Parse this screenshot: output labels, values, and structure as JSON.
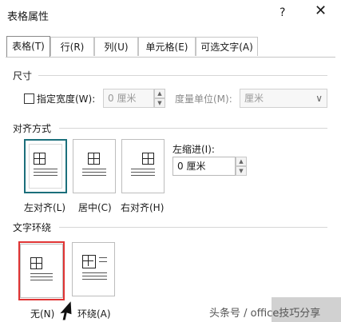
{
  "dialog": {
    "title": "表格属性",
    "help": "?",
    "close": "✕"
  },
  "tabs": [
    {
      "label": "表格(T)"
    },
    {
      "label": "行(R)"
    },
    {
      "label": "列(U)"
    },
    {
      "label": "单元格(E)"
    },
    {
      "label": "可选文字(A)"
    }
  ],
  "size_section": {
    "title": "尺寸",
    "preferred_width_label": "指定宽度(W):",
    "width_value": "0 厘米",
    "measure_label": "度量单位(M):",
    "measure_value": "厘米"
  },
  "align_section": {
    "title": "对齐方式",
    "options": [
      {
        "label": "左对齐(L)"
      },
      {
        "label": "居中(C)"
      },
      {
        "label": "右对齐(H)"
      }
    ],
    "indent_label": "左缩进(I):",
    "indent_value": "0 厘米"
  },
  "wrap_section": {
    "title": "文字环绕",
    "options": [
      {
        "label": "无(N)"
      },
      {
        "label": "环绕(A)"
      }
    ]
  },
  "watermark": "头条号 / office技巧分享"
}
